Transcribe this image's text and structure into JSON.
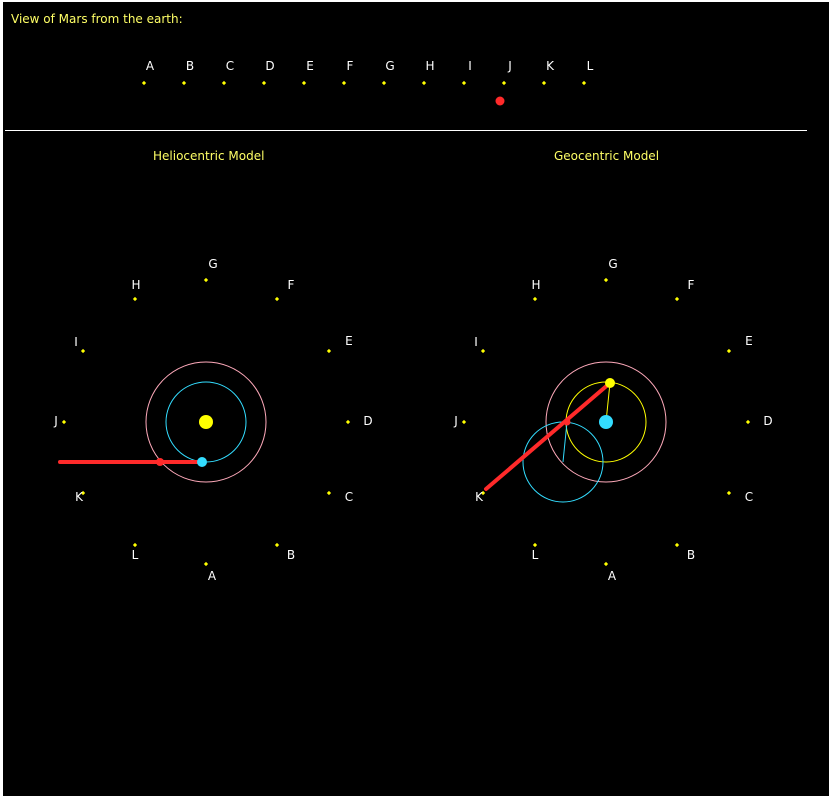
{
  "title": "View of Mars from the earth:",
  "sky_labels": [
    "A",
    "B",
    "C",
    "D",
    "E",
    "F",
    "G",
    "H",
    "I",
    "J",
    "K",
    "L"
  ],
  "mars_position_index": 8.9,
  "heliocentric": {
    "title": "Heliocentric Model",
    "sight_line_to": "J"
  },
  "geocentric": {
    "title": "Geocentric Model",
    "sight_line_to": "K"
  },
  "colors": {
    "background": "#000000",
    "title_text": "#ffff66",
    "label_text": "#ffffff",
    "star_marker": "#ffff00",
    "sun": "#ffff00",
    "earth": "#33ddff",
    "mars": "#ff2a2a",
    "sight_line": "#ff2a2a",
    "earth_orbit": "#33ddff",
    "mars_orbit": "#ffaabb",
    "sun_orbit": "#ffff00",
    "epicycle": "#33ddff"
  }
}
